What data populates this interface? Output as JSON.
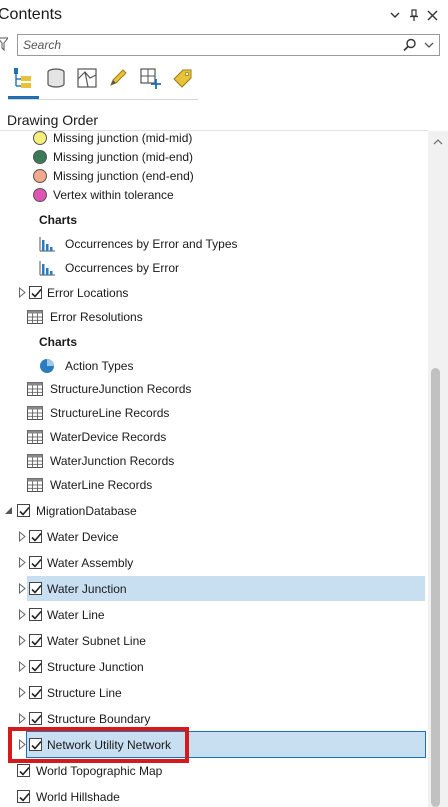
{
  "pane": {
    "title": "Contents"
  },
  "header_buttons": [
    "options-icon",
    "pin-icon",
    "close-icon"
  ],
  "search": {
    "placeholder": "Search"
  },
  "toolbar": [
    "list-by-drawing-order-icon",
    "list-by-source-icon",
    "list-by-selection-icon",
    "list-by-editing-icon",
    "list-by-snapping-icon",
    "list-by-labeling-icon"
  ],
  "section": {
    "label": "Drawing Order"
  },
  "legend_items": [
    {
      "label": "Missing junction (mid-mid)",
      "color": "#f3ef7a"
    },
    {
      "label": "Missing junction (mid-end)",
      "color": "#3a7a55"
    },
    {
      "label": "Missing junction (end-end)",
      "color": "#f2a98c"
    },
    {
      "label": "Vertex within tolerance",
      "color": "#e055b4"
    }
  ],
  "charts_heading_1": "Charts",
  "charts_1": [
    "Occurrences by Error and Types",
    "Occurrences by Error"
  ],
  "error_locations": "Error Locations",
  "error_resolutions": "Error Resolutions",
  "charts_heading_2": "Charts",
  "charts_2": [
    "Action Types"
  ],
  "tables": [
    "StructureJunction Records",
    "StructureLine Records",
    "WaterDevice Records",
    "WaterJunction Records",
    "WaterLine Records"
  ],
  "group": {
    "label": "MigrationDatabase"
  },
  "group_layers": [
    "Water Device",
    "Water Assembly",
    "Water Junction",
    "Water Line",
    "Water Subnet Line",
    "Structure Junction",
    "Structure Line",
    "Structure Boundary",
    "Network Utility Network"
  ],
  "basemaps": [
    "World Topographic Map",
    "World Hillshade"
  ],
  "colors": {
    "accent": "#1f6fb5",
    "selection": "#c8dff2",
    "callout": "#d6191b"
  }
}
